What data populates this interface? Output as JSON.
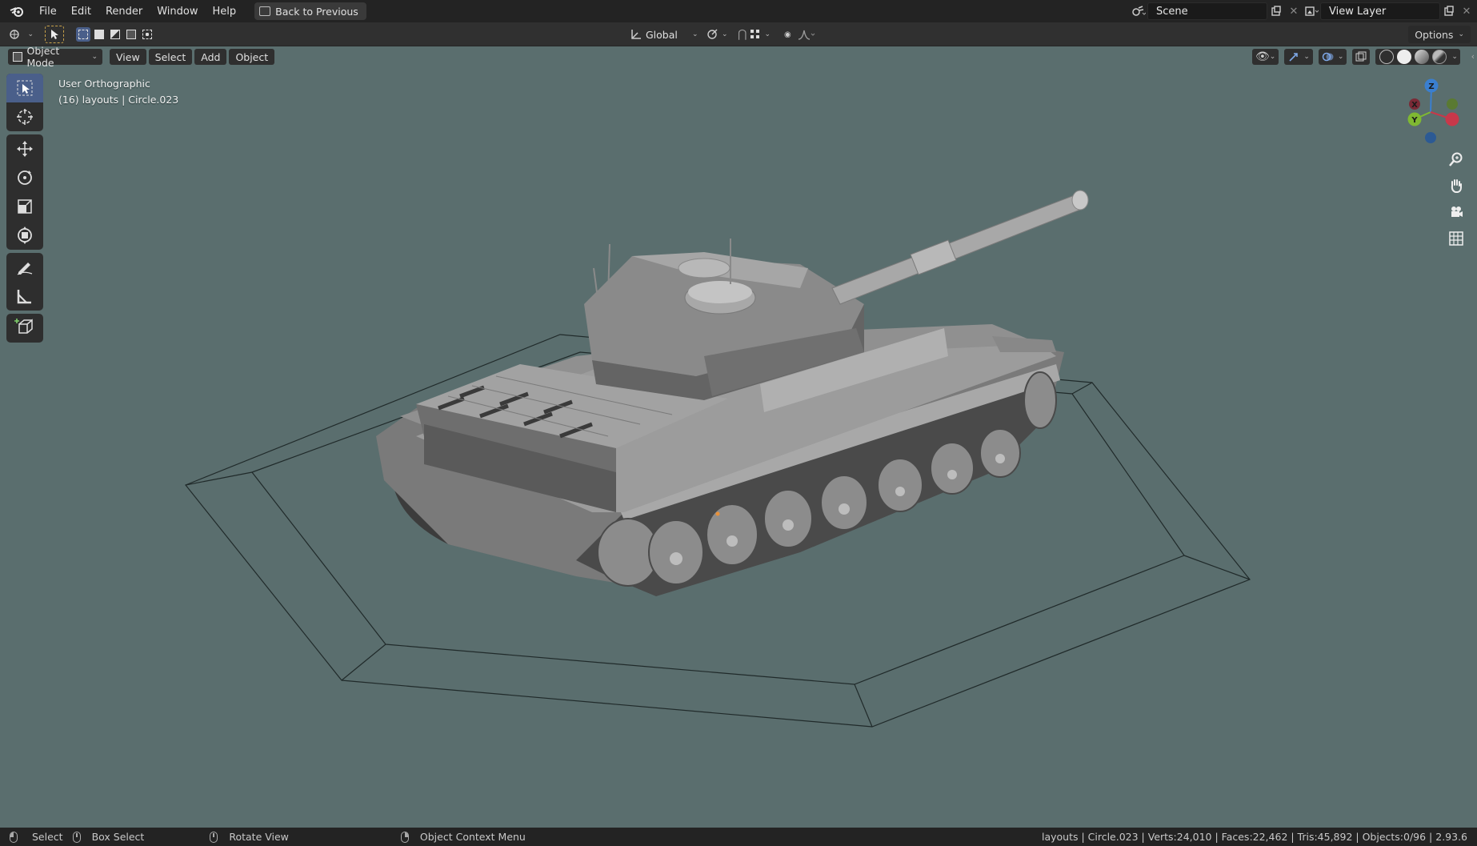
{
  "topbar": {
    "menus": [
      "File",
      "Edit",
      "Render",
      "Window",
      "Help"
    ],
    "back_label": "Back to Previous",
    "scene": "Scene",
    "view_layer": "View Layer"
  },
  "toolheader": {
    "orientation": "Global",
    "options": "Options"
  },
  "viewport_header": {
    "mode": "Object Mode",
    "menus": [
      "View",
      "Select",
      "Add",
      "Object"
    ]
  },
  "viewport": {
    "view_name": "User Orthographic",
    "collection_info": "(16) layouts | Circle.023",
    "background": "#5a6e6e"
  },
  "gizmo": {
    "x": "X",
    "y": "Y",
    "z": "Z"
  },
  "toolbar": {
    "tools": [
      "select-box",
      "cursor",
      "move",
      "rotate",
      "scale",
      "transform",
      "annotate",
      "measure",
      "add-cube"
    ],
    "active": "select-box"
  },
  "statusbar": {
    "select": "Select",
    "box_select": "Box Select",
    "rotate_view": "Rotate View",
    "context_menu": "Object Context Menu",
    "stats": "layouts | Circle.023 | Verts:24,010 | Faces:22,462 | Tris:45,892 | Objects:0/96 | 2.93.6"
  },
  "colors": {
    "accent": "#4a5f8a",
    "axis_x": "#c8384a",
    "axis_y": "#7fb832",
    "axis_z": "#3a7fd0"
  }
}
